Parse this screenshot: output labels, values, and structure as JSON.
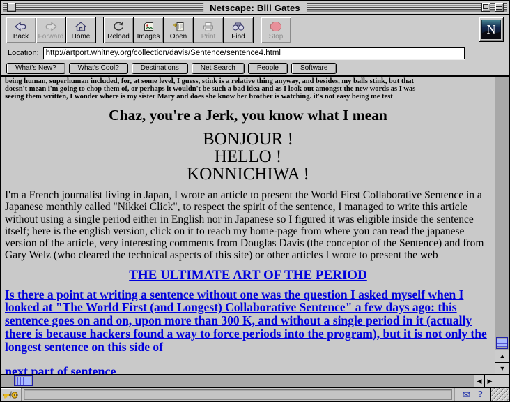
{
  "window": {
    "title": "Netscape: Bill Gates"
  },
  "colors": {
    "link": "#0000dd",
    "chrome": "#cccccc",
    "content_bg": "#c9c9c9",
    "scroll_thumb": "#9999ff",
    "stop_red": "#e8909a",
    "status_blue": "#2233aa"
  },
  "toolbar": {
    "buttons": [
      {
        "label": "Back",
        "icon": "back-arrow",
        "disabled": false
      },
      {
        "label": "Forward",
        "icon": "forward-arrow",
        "disabled": true
      },
      {
        "label": "Home",
        "icon": "house",
        "disabled": false
      },
      {
        "label": "Reload",
        "icon": "reload-circle",
        "disabled": false
      },
      {
        "label": "Images",
        "icon": "picture",
        "disabled": false
      },
      {
        "label": "Open",
        "icon": "document",
        "disabled": false
      },
      {
        "label": "Print",
        "icon": "printer",
        "disabled": true
      },
      {
        "label": "Find",
        "icon": "binoculars",
        "disabled": false
      },
      {
        "label": "Stop",
        "icon": "stop-octagon",
        "disabled": true
      }
    ],
    "logo": "N"
  },
  "location": {
    "label": "Location:",
    "value": "http://artport.whitney.org/collection/davis/Sentence/sentence4.html"
  },
  "directory": {
    "buttons": [
      "What's New?",
      "What's Cool?",
      "Destinations",
      "Net Search",
      "People",
      "Software"
    ]
  },
  "content": {
    "intro_lines": [
      "being human, superhuman included, for, at some level, I guess, stink is a relative thing anyway, and besides, my balls stink, but that",
      "doesn't mean i'm going to chop them of, or perhaps it wouldn't be such a bad idea and as I look out amongst the new words as I was",
      "seeing them written, I wonder where is my sister Mary and does she know her brother is watching. it's not easy being me test"
    ],
    "heading": "Chaz, you're a Jerk, you know what I mean",
    "greetings": [
      "BONJOUR !",
      "HELLO !",
      "KONNICHIWA !"
    ],
    "paragraph": "I'm a French journalist living in Japan, I wrote an article to present the World First Collaborative Sentence in a Japanese monthly called \"Nikkei Click\", to respect the spirit of the sentence, I managed to write this article without using a single period either in English nor in Japanese so I figured it was eligible inside the sentence itself; here is the english version, click on it to reach my home-page from where you can read the japanese version of the article, very interesting comments from Douglas Davis (the conceptor of the Sentence) and from Gary Welz (who cleared the technical aspects of this site) or other articles I wrote to present the web",
    "center_link": "THE ULTIMATE ART OF THE PERIOD",
    "blue_paragraph": "Is there a point at writing a sentence without one was the question I asked myself when I looked at \"The World First (and Longest) Collaborative Sentence\" a few days ago: this sentence goes on and on, upon more than 300 K, and without a single period in it (actually there is because hackers found a way to force periods into the program), but it is not only the longest sentence on this side of ",
    "next_link": "next part of sentence "
  },
  "icons": {
    "scroll_up": "▲",
    "scroll_down": "▼",
    "scroll_left": "◀",
    "scroll_right": "▶",
    "mail": "✉",
    "help": "?"
  },
  "status": {
    "text": ""
  }
}
